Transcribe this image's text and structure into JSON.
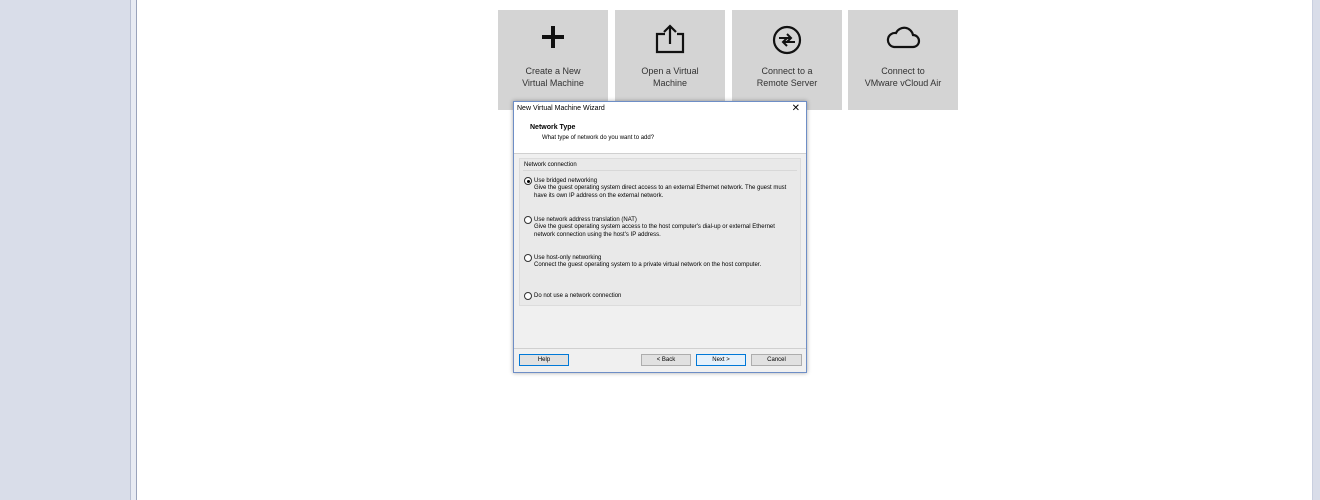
{
  "tiles": [
    {
      "label": "Create a New\nVirtual Machine",
      "icon": "plus-icon"
    },
    {
      "label": "Open a Virtual\nMachine",
      "icon": "open-folder-icon"
    },
    {
      "label": "Connect to a\nRemote Server",
      "icon": "remote-server-icon"
    },
    {
      "label": "Connect to\nVMware vCloud Air",
      "icon": "cloud-icon"
    }
  ],
  "dialog": {
    "title": "New Virtual Machine Wizard",
    "close_glyph": "✕",
    "header_title": "Network Type",
    "header_subtitle": "What type of network do you want to add?",
    "group_label": "Network connection",
    "options": [
      {
        "label": "Use bridged networking",
        "description": "Give the guest operating system direct access to an external Ethernet network. The guest must have its own IP address on the external network.",
        "selected": true
      },
      {
        "label": "Use network address translation (NAT)",
        "description": "Give the guest operating system access to the host computer's dial-up or external Ethernet network connection using the host's IP address.",
        "selected": false
      },
      {
        "label": "Use host-only networking",
        "description": "Connect the guest operating system to a private virtual network on the host computer.",
        "selected": false
      },
      {
        "label": "Do not use a network connection",
        "description": "",
        "selected": false
      }
    ],
    "buttons": {
      "help": "Help",
      "back": "< Back",
      "next": "Next >",
      "cancel": "Cancel"
    }
  },
  "colors": {
    "sidebar": "#d9dde9",
    "tile": "#d4d4d4",
    "accent": "#0078d7"
  }
}
